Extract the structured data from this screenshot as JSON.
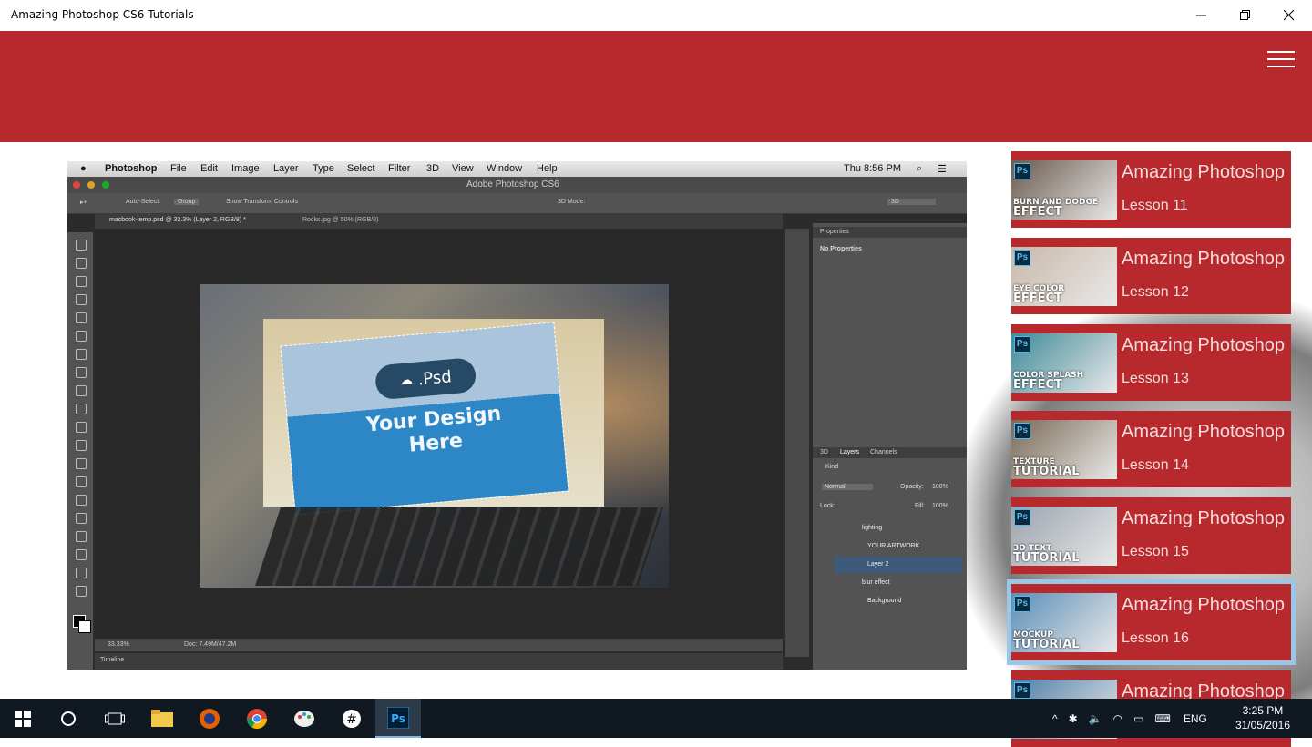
{
  "window": {
    "title": "Amazing Photoshop CS6 Tutorials",
    "controls": [
      "minimize",
      "restore",
      "close"
    ]
  },
  "header": {
    "color": "#b7292d",
    "menu_icon": "hamburger-icon"
  },
  "video": {
    "menubar": {
      "app": "Photoshop",
      "items": [
        "File",
        "Edit",
        "Image",
        "Layer",
        "Type",
        "Select",
        "Filter",
        "3D",
        "View",
        "Window",
        "Help"
      ],
      "clock": "Thu 8:56 PM"
    },
    "app_title": "Adobe Photoshop CS6",
    "options": {
      "auto_select": "Auto-Select:",
      "group": "Group",
      "transform": "Show Transform Controls",
      "mode3d": "3D Mode:",
      "workspace": "3D"
    },
    "tabs": [
      "macbook-temp.psd @ 33.3% (Layer 2, RGB/8) *",
      "Rocks.jpg @ 50% (RGB/8)"
    ],
    "canvas": {
      "pill_text": ".Psd",
      "design_text": "Your Design Here"
    },
    "panels": {
      "properties_title": "Properties",
      "no_properties": "No Properties",
      "layer_tabs": [
        "3D",
        "Layers",
        "Channels"
      ],
      "kind": "Kind",
      "blend": "Normal",
      "opacity_label": "Opacity:",
      "opacity": "100%",
      "lock_label": "Lock:",
      "fill_label": "Fill:",
      "fill": "100%",
      "layers": [
        "lighting",
        "YOUR ARTWORK",
        "Layer 2",
        "blur effect",
        "Background"
      ],
      "selected_layer": "Layer 2"
    },
    "status": {
      "zoom": "33.33%",
      "doc": "Doc: 7.49M/47.2M"
    },
    "timeline": "Timeline"
  },
  "lessons": [
    {
      "title": "Amazing Photoshop",
      "subtitle": "Lesson 11",
      "thumb_small": "BURN AND DODGE",
      "thumb_big": "EFFECT",
      "thumb_color": "#6b5a4e"
    },
    {
      "title": "Amazing Photoshop",
      "subtitle": "Lesson 12",
      "thumb_small": "EYE COLOR",
      "thumb_big": "EFFECT",
      "thumb_color": "#c9b8a8"
    },
    {
      "title": "Amazing Photoshop",
      "subtitle": "Lesson 13",
      "thumb_small": "COLOR SPLASH",
      "thumb_big": "EFFECT",
      "thumb_color": "#3f8a9a"
    },
    {
      "title": "Amazing Photoshop",
      "subtitle": "Lesson 14",
      "thumb_small": "TEXTURE",
      "thumb_big": "TUTORIAL",
      "thumb_color": "#7a6a55"
    },
    {
      "title": "Amazing Photoshop",
      "subtitle": "Lesson 15",
      "thumb_small": "3D TEXT",
      "thumb_big": "TUTORIAL",
      "thumb_color": "#9aa3ad"
    },
    {
      "title": "Amazing Photoshop",
      "subtitle": "Lesson 16",
      "thumb_small": "MOCKUP",
      "thumb_big": "TUTORIAL",
      "thumb_color": "#5b8fb8",
      "selected": true
    },
    {
      "title": "Amazing Photoshop",
      "subtitle": "",
      "thumb_small": "",
      "thumb_big": "",
      "thumb_color": "#4f7ea8"
    }
  ],
  "taskbar": {
    "apps": [
      "windows-start-icon",
      "cortana-icon",
      "task-view-icon",
      "file-explorer-icon",
      "firefox-icon",
      "chrome-icon",
      "paint-icon",
      "app-icon",
      "photoshop-icon"
    ],
    "active_app": "photoshop-icon",
    "language": "ENG",
    "time": "3:25 PM",
    "date": "31/05/2016"
  }
}
